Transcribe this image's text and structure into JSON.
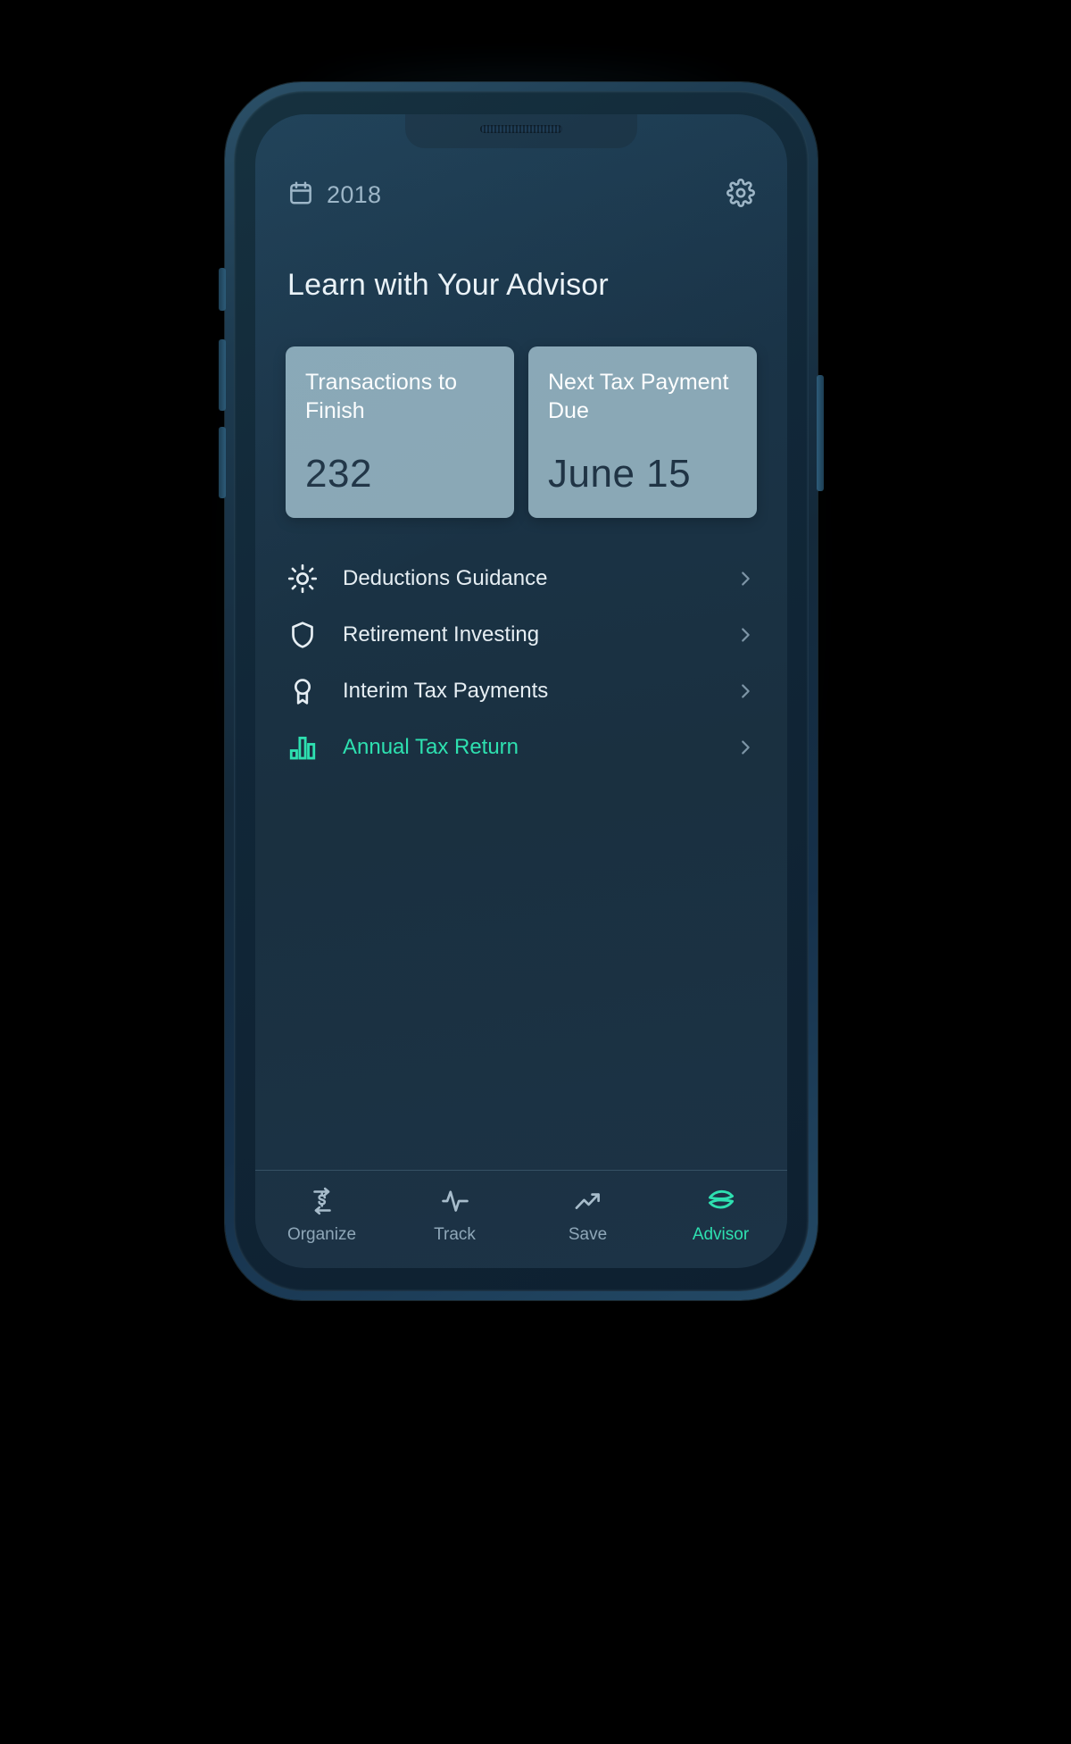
{
  "statusbar": {
    "year": "2018",
    "calendar_icon": "calendar-icon",
    "settings_icon": "gear-icon"
  },
  "header": {
    "title": "Learn with Your Advisor"
  },
  "cards": [
    {
      "label": "Transactions to Finish",
      "value": "232",
      "name": "transactions-to-finish"
    },
    {
      "label": "Next Tax Payment Due",
      "value": "June 15",
      "name": "next-tax-payment-due"
    }
  ],
  "list": [
    {
      "label": "Deductions Guidance",
      "icon": "sun-icon",
      "active": false
    },
    {
      "label": "Retirement Investing",
      "icon": "shield-icon",
      "active": false
    },
    {
      "label": "Interim Tax Payments",
      "icon": "award-ribbon-icon",
      "active": false
    },
    {
      "label": "Annual Tax Return",
      "icon": "bar-chart-icon",
      "active": true
    }
  ],
  "nav": [
    {
      "label": "Organize",
      "icon": "exchange-dollar-icon",
      "active": false
    },
    {
      "label": "Track",
      "icon": "activity-pulse-icon",
      "active": false
    },
    {
      "label": "Save",
      "icon": "trending-up-icon",
      "active": false
    },
    {
      "label": "Advisor",
      "icon": "advisor-layers-icon",
      "active": true
    }
  ],
  "colors": {
    "accent": "#2ee0b0",
    "screen_bg": "#1a3040",
    "card_bg": "#8aa8b6",
    "card_value": "#203445",
    "muted_text": "#8fa7b8"
  }
}
